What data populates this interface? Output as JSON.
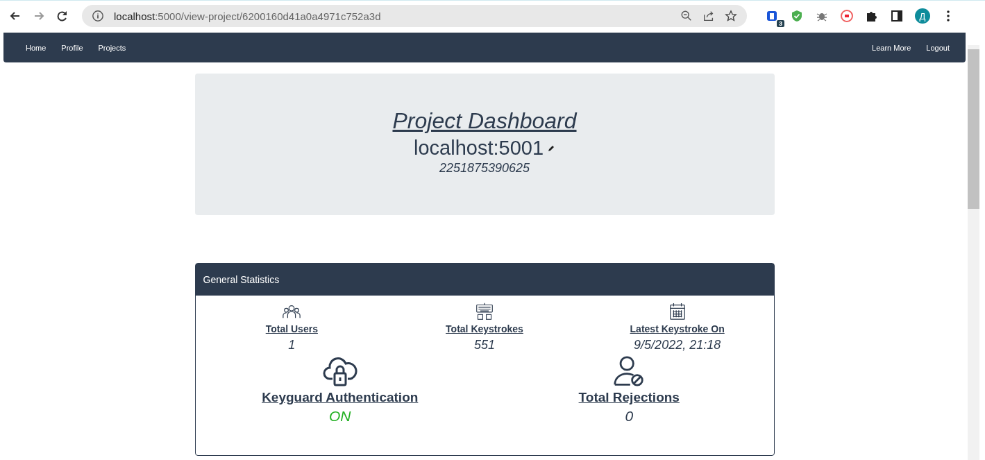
{
  "browser": {
    "url_host": "localhost",
    "url_path": ":5000/view-project/6200160d41a0a4971c752a3d",
    "extension_badge": "3",
    "avatar": "Д"
  },
  "nav": {
    "left": [
      "Home",
      "Profile",
      "Projects"
    ],
    "right": [
      "Learn More",
      "Logout"
    ]
  },
  "header": {
    "title": "Project Dashboard",
    "name": "localhost:5001",
    "id": "2251875390625"
  },
  "card": {
    "title": "General Statistics",
    "top": [
      {
        "kind": "users",
        "label": "Total Users",
        "value": "1",
        "highlight": false
      },
      {
        "kind": "keyboard",
        "label": "Total Keystrokes",
        "value": "551",
        "highlight": false
      },
      {
        "kind": "calendar",
        "label": "Latest Keystroke On",
        "value": "9/5/2022, 21:18",
        "highlight": false
      }
    ],
    "bottom": [
      {
        "kind": "cloud-lock",
        "label": "Keyguard Authentication",
        "value": "ON",
        "highlight": true
      },
      {
        "kind": "user-block",
        "label": "Total Rejections",
        "value": "0",
        "highlight": false
      }
    ]
  }
}
